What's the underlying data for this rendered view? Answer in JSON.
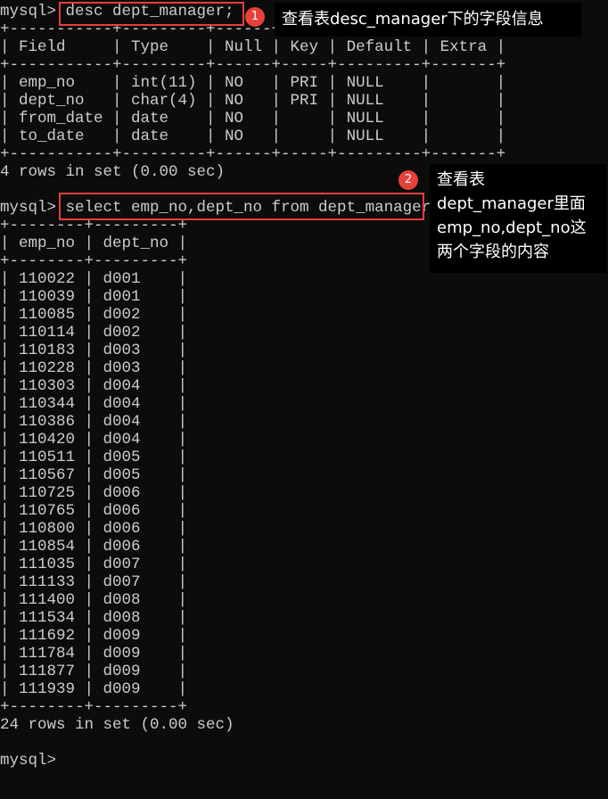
{
  "terminal": {
    "lines": [
      "mysql> desc dept_manager;",
      "+-----------+---------+------+-----+---------+-------+",
      "| Field     | Type    | Null | Key | Default | Extra |",
      "+-----------+---------+------+-----+---------+-------+",
      "| emp_no    | int(11) | NO   | PRI | NULL    |       |",
      "| dept_no   | char(4) | NO   | PRI | NULL    |       |",
      "| from_date | date    | NO   |     | NULL    |       |",
      "| to_date   | date    | NO   |     | NULL    |       |",
      "+-----------+---------+------+-----+---------+-------+",
      "4 rows in set (0.00 sec)",
      "",
      "mysql> select emp_no,dept_no from dept_manager;",
      "+--------+---------+",
      "| emp_no | dept_no |",
      "+--------+---------+",
      "| 110022 | d001    |",
      "| 110039 | d001    |",
      "| 110085 | d002    |",
      "| 110114 | d002    |",
      "| 110183 | d003    |",
      "| 110228 | d003    |",
      "| 110303 | d004    |",
      "| 110344 | d004    |",
      "| 110386 | d004    |",
      "| 110420 | d004    |",
      "| 110511 | d005    |",
      "| 110567 | d005    |",
      "| 110725 | d006    |",
      "| 110765 | d006    |",
      "| 110800 | d006    |",
      "| 110854 | d006    |",
      "| 111035 | d007    |",
      "| 111133 | d007    |",
      "| 111400 | d008    |",
      "| 111534 | d008    |",
      "| 111692 | d009    |",
      "| 111784 | d009    |",
      "| 111877 | d009    |",
      "| 111939 | d009    |",
      "+--------+---------+",
      "24 rows in set (0.00 sec)",
      "",
      "mysql>"
    ]
  },
  "annotations": {
    "badge_1": "1",
    "note_1": "查看表desc_manager下的字段信息",
    "badge_2": "2",
    "note_2": "查看表dept_manager里面emp_no,dept_no这两个字段的内容"
  },
  "colors": {
    "background": "#0c0c0c",
    "text": "#cccccc",
    "highlight": "#e8403a"
  }
}
